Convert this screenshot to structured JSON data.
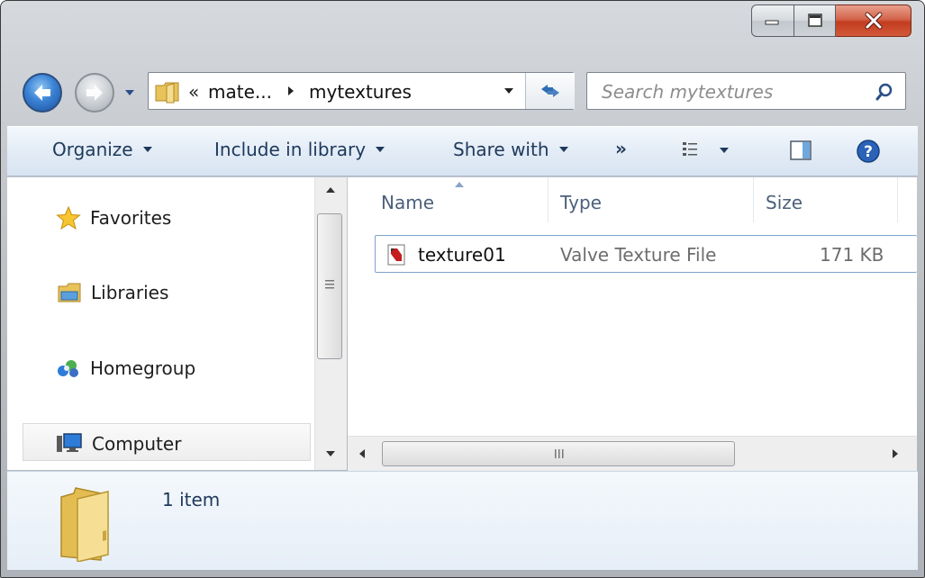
{
  "window": {
    "caption_buttons": [
      "minimize",
      "maximize",
      "close"
    ]
  },
  "address": {
    "overflow": "«",
    "segments": [
      "mate...",
      "mytextures"
    ]
  },
  "search": {
    "placeholder": "Search mytextures"
  },
  "toolbar": {
    "organize": "Organize",
    "include_in_library": "Include in library",
    "share_with": "Share with",
    "more": "»"
  },
  "nav": {
    "favorites": "Favorites",
    "libraries": "Libraries",
    "homegroup": "Homegroup",
    "computer": "Computer"
  },
  "columns": {
    "name": "Name",
    "type": "Type",
    "size": "Size"
  },
  "files": [
    {
      "name": "texture01",
      "type": "Valve Texture File",
      "size": "171 KB"
    }
  ],
  "status": {
    "item_count": "1 item"
  },
  "colors": {
    "accent": "#1e395b",
    "selection_border": "#7da2ce",
    "toolbar_bg": "#e3ecf6"
  }
}
